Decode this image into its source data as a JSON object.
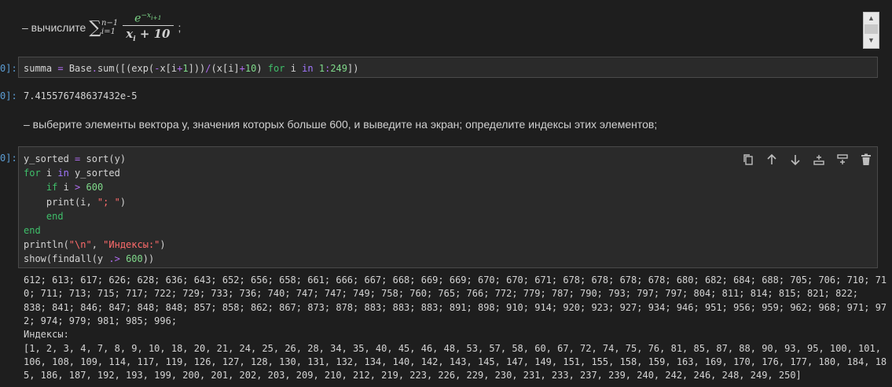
{
  "markdown_top": {
    "prefix": "– вычислите",
    "sum_upper": "n−1",
    "sum_lower": "i=1",
    "numerator_base": "e",
    "numerator_exp": "−x",
    "numerator_exp_sub": "i+1",
    "denominator_var": "x",
    "denominator_sub": "i",
    "denominator_rest": " + 10",
    "suffix": ";"
  },
  "cell1": {
    "prompt": "0]:",
    "code": [
      [
        [
          "",
          "summa "
        ],
        [
          "op",
          "="
        ],
        [
          "",
          " Base"
        ],
        [
          "op",
          "."
        ],
        [
          "",
          "sum([(exp("
        ],
        [
          "op",
          "-"
        ],
        [
          "",
          "x[i"
        ],
        [
          "op",
          "+"
        ],
        [
          "num",
          "1"
        ],
        [
          "",
          "]))"
        ],
        [
          "op",
          "/"
        ],
        [
          "",
          "(x[i]"
        ],
        [
          "op",
          "+"
        ],
        [
          "num",
          "10"
        ],
        [
          "",
          ") "
        ],
        [
          "kw2",
          "for"
        ],
        [
          "",
          " i "
        ],
        [
          "kw",
          "in"
        ],
        [
          "",
          " "
        ],
        [
          "num",
          "1"
        ],
        [
          "op",
          ":"
        ],
        [
          "num",
          "249"
        ],
        [
          "",
          "])"
        ]
      ]
    ],
    "output_prompt": "0]:",
    "output": "7.415576748637432e-5"
  },
  "markdown_mid": {
    "text": "– выберите элементы вектора y, значения которых больше 600, и выведите на экран; определите индексы этих элементов;"
  },
  "cell2": {
    "prompt": "0]:",
    "code": [
      [
        [
          "",
          "y_sorted "
        ],
        [
          "op",
          "="
        ],
        [
          "",
          " sort(y)"
        ]
      ],
      [
        [
          "kw2",
          "for"
        ],
        [
          "",
          " i "
        ],
        [
          "kw",
          "in"
        ],
        [
          "",
          " y_sorted"
        ]
      ],
      [
        [
          "",
          "    "
        ],
        [
          "kw2",
          "if"
        ],
        [
          "",
          " i "
        ],
        [
          "op",
          ">"
        ],
        [
          "",
          " "
        ],
        [
          "num",
          "600"
        ]
      ],
      [
        [
          "",
          "    print(i, "
        ],
        [
          "str",
          "\"; \""
        ],
        [
          "",
          ")"
        ]
      ],
      [
        [
          "",
          "    "
        ],
        [
          "kw2",
          "end"
        ]
      ],
      [
        [
          "kw2",
          "end"
        ]
      ],
      [
        [
          "",
          "println("
        ],
        [
          "str",
          "\"\\n\""
        ],
        [
          "",
          ", "
        ],
        [
          "str",
          "\"Индексы:\""
        ],
        [
          "",
          ")"
        ]
      ],
      [
        [
          "",
          "show(findall(y "
        ],
        [
          "op",
          ".>"
        ],
        [
          "",
          " "
        ],
        [
          "num",
          "600"
        ],
        [
          "",
          "))"
        ]
      ]
    ],
    "toolbar_icons": [
      "copy-icon",
      "arrow-up-icon",
      "arrow-down-icon",
      "insert-below-icon",
      "split-cell-icon",
      "trash-icon"
    ],
    "output": [
      "612; 613; 617; 626; 628; 636; 643; 652; 656; 658; 661; 666; 667; 668; 669; 669; 670; 670; 671; 678; 678; 678; 678; 680; 682; 684; 688; 705; 706; 710; 71",
      "0; 711; 713; 715; 717; 722; 729; 733; 736; 740; 747; 747; 749; 758; 760; 765; 766; 772; 779; 787; 790; 793; 797; 797; 804; 811; 814; 815; 821; 822;",
      "838; 841; 846; 847; 848; 848; 857; 858; 862; 867; 873; 878; 883; 883; 883; 891; 898; 910; 914; 920; 923; 927; 934; 946; 951; 956; 959; 962; 968; 971; 97",
      "2; 974; 979; 981; 985; 996;",
      "Индексы:",
      "[1, 2, 3, 4, 7, 8, 9, 10, 18, 20, 21, 24, 25, 26, 28, 34, 35, 40, 45, 46, 48, 53, 57, 58, 60, 67, 72, 74, 75, 76, 81, 85, 87, 88, 90, 93, 95, 100, 101,",
      "106, 108, 109, 114, 117, 119, 126, 127, 128, 130, 131, 132, 134, 140, 142, 143, 145, 147, 149, 151, 155, 158, 159, 163, 169, 170, 176, 177, 180, 184, 18",
      "5, 186, 187, 192, 193, 199, 200, 201, 202, 203, 209, 210, 212, 219, 223, 226, 229, 230, 231, 233, 237, 239, 240, 242, 246, 248, 249, 250]"
    ]
  }
}
